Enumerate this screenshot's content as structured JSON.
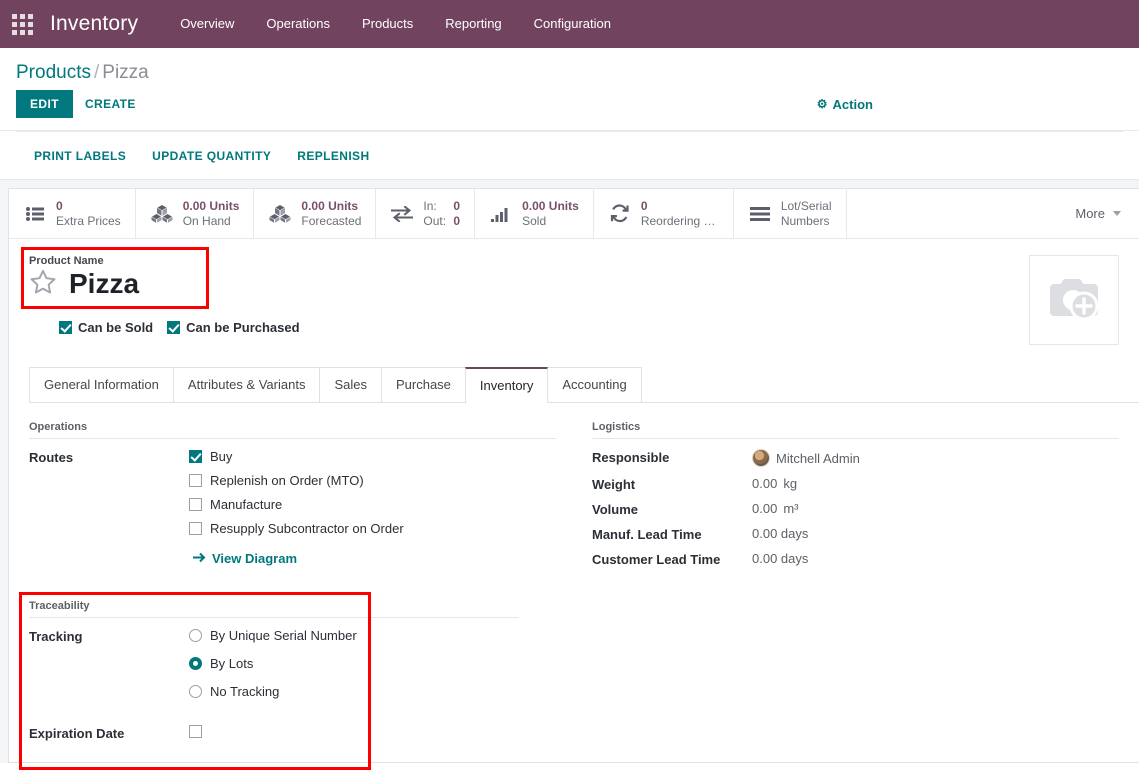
{
  "theme": {
    "navbar_bg": "#71435f",
    "accent": "#00787d",
    "stat_value_color": "#7a4f68",
    "highlight_color": "#fc0000"
  },
  "navbar": {
    "apps_icon": "apps-grid-icon",
    "brand": "Inventory",
    "menu": [
      {
        "label": "Overview"
      },
      {
        "label": "Operations"
      },
      {
        "label": "Products"
      },
      {
        "label": "Reporting"
      },
      {
        "label": "Configuration"
      }
    ]
  },
  "control_panel": {
    "breadcrumb": {
      "parent": "Products",
      "separator": "/",
      "current": "Pizza"
    },
    "edit_label": "EDIT",
    "create_label": "CREATE",
    "action_label": "Action",
    "action_icon": "gear-icon",
    "extra_buttons": [
      {
        "label": "PRINT LABELS"
      },
      {
        "label": "UPDATE QUANTITY"
      },
      {
        "label": "REPLENISH"
      }
    ]
  },
  "stat_buttons": [
    {
      "icon": "list-icon",
      "value": "0",
      "label": "Extra Prices"
    },
    {
      "icon": "boxes-icon",
      "value": "0.00 Units",
      "label": "On Hand"
    },
    {
      "icon": "boxes-icon",
      "value": "0.00 Units",
      "label": "Forecasted"
    },
    {
      "icon": "exchange-icon",
      "in_label": "In:",
      "in_value": "0",
      "out_label": "Out:",
      "out_value": "0"
    },
    {
      "icon": "bar-chart-icon",
      "value": "0.00 Units",
      "label": "Sold"
    },
    {
      "icon": "refresh-icon",
      "value": "0",
      "label": "Reordering R..."
    },
    {
      "icon": "lines-icon",
      "label_line1": "Lot/Serial",
      "label_line2": "Numbers"
    }
  ],
  "more_button": {
    "label": "More",
    "icon": "caret-down-icon"
  },
  "product": {
    "name_label": "Product Name",
    "name": "Pizza",
    "star_icon": "star-outline-icon",
    "image_placeholder_icon": "camera-add-icon",
    "checkboxes": [
      {
        "label": "Can be Sold",
        "checked": true
      },
      {
        "label": "Can be Purchased",
        "checked": true
      }
    ]
  },
  "tabs": [
    {
      "label": "General Information",
      "active": false
    },
    {
      "label": "Attributes & Variants",
      "active": false
    },
    {
      "label": "Sales",
      "active": false
    },
    {
      "label": "Purchase",
      "active": false
    },
    {
      "label": "Inventory",
      "active": true
    },
    {
      "label": "Accounting",
      "active": false
    }
  ],
  "operations": {
    "group_title": "Operations",
    "routes_label": "Routes",
    "routes": [
      {
        "label": "Buy",
        "checked": true
      },
      {
        "label": "Replenish on Order (MTO)",
        "checked": false
      },
      {
        "label": "Manufacture",
        "checked": false
      },
      {
        "label": "Resupply Subcontractor on Order",
        "checked": false
      }
    ],
    "view_diagram_label": "View Diagram",
    "view_diagram_icon": "arrow-right-icon"
  },
  "logistics": {
    "group_title": "Logistics",
    "rows": [
      {
        "label": "Responsible",
        "value": "Mitchell Admin",
        "avatar": "user-avatar"
      },
      {
        "label": "Weight",
        "value": "0.00",
        "unit": "kg"
      },
      {
        "label": "Volume",
        "value": "0.00",
        "unit": "m³"
      },
      {
        "label": "Manuf. Lead Time",
        "value": "0.00 days",
        "unit": ""
      },
      {
        "label": "Customer Lead Time",
        "value": "0.00 days",
        "unit": ""
      }
    ]
  },
  "traceability": {
    "group_title": "Traceability",
    "tracking_label": "Tracking",
    "tracking_options": [
      {
        "label": "By Unique Serial Number",
        "selected": false
      },
      {
        "label": "By Lots",
        "selected": true
      },
      {
        "label": "No Tracking",
        "selected": false
      }
    ],
    "expiration_label": "Expiration Date",
    "expiration_checked": false
  }
}
